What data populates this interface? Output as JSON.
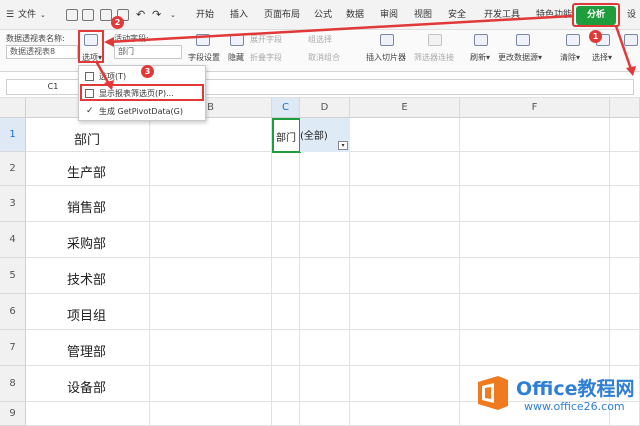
{
  "menubar": {
    "file_label": "文件",
    "tabs": [
      "开始",
      "插入",
      "页面布局",
      "公式",
      "数据",
      "审阅",
      "视图",
      "安全",
      "开发工具",
      "特色功能"
    ],
    "active_tab": "分析",
    "extra_tab": "设"
  },
  "ribbon": {
    "pivot_name_label": "数据透视表名称:",
    "pivot_name_value": "数据透视表8",
    "active_field_label": "活动字段:",
    "active_field_value": "部门",
    "options_label": "选项",
    "field_settings": "字段设置",
    "hide": "隐藏",
    "expand_field": "展开字段",
    "collapse_field": "折叠字段",
    "group_select": "组选择",
    "ungroup": "取消组合",
    "insert_slicer": "插入切片器",
    "filter_connections": "筛选器连接",
    "refresh": "刷新",
    "change_source": "更改数据源",
    "clear": "清除",
    "select": "选择"
  },
  "formula_bar": {
    "name_box": "C1"
  },
  "grid": {
    "columns": [
      "A",
      "B",
      "C",
      "D",
      "E",
      "F"
    ],
    "rows": [
      "1",
      "2",
      "3",
      "4",
      "5",
      "6",
      "7",
      "8",
      "9"
    ],
    "column_a": [
      "部门",
      "生产部",
      "销售部",
      "采购部",
      "技术部",
      "项目组",
      "管理部",
      "设备部"
    ],
    "c1": "部门",
    "d1": "(全部)"
  },
  "dropdown": {
    "items": [
      "选项(T)",
      "显示报表筛选页(P)...",
      "生成 GetPivotData(G)"
    ]
  },
  "annotations": [
    "1",
    "2",
    "3"
  ],
  "watermark": {
    "brand": "Office教程网",
    "url": "www.office26.com"
  },
  "colors": {
    "accent_red": "#e13838",
    "active_tab_green": "#1f9d3c",
    "brand_blue": "#2f7fd6",
    "logo_orange": "#f07a1f"
  }
}
